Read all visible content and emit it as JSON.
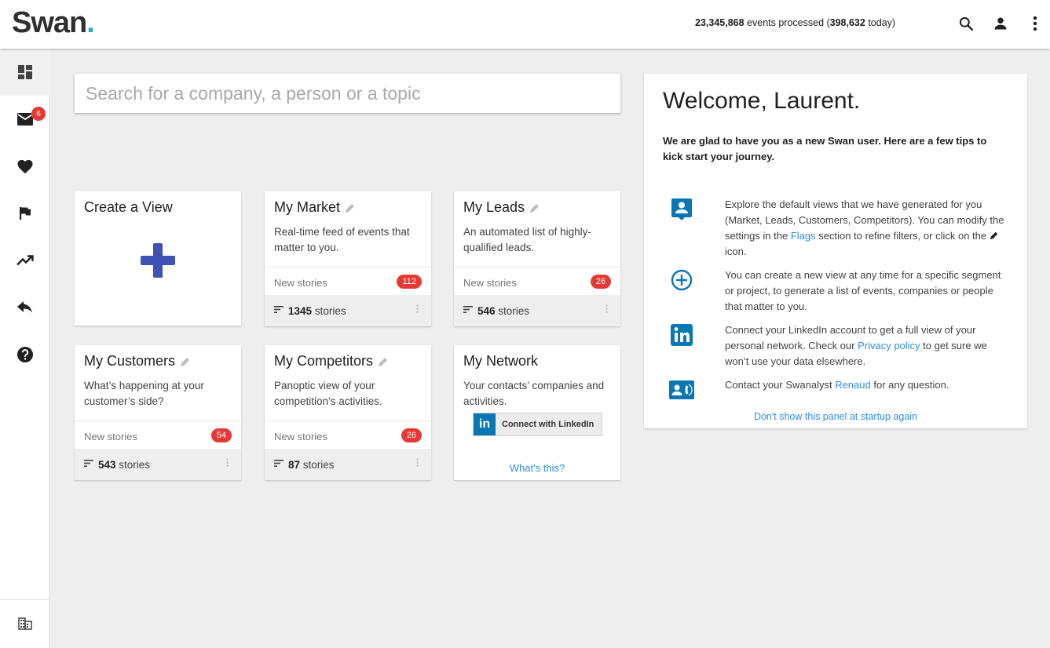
{
  "app": {
    "logo_text": "Swan",
    "logo_dot": ".",
    "brand_color": "#2f2f2f",
    "accent_color": "#2aa9e0"
  },
  "header": {
    "events_total": "23,345,868",
    "events_label": "events processed (",
    "events_today": "398,632",
    "events_suffix": "today)",
    "icons": [
      "search-icon",
      "account-icon",
      "more-vert-icon"
    ]
  },
  "sidebar": {
    "items": [
      {
        "icon": "dashboard-icon",
        "active": true
      },
      {
        "icon": "mail-icon",
        "badge": "6"
      },
      {
        "icon": "heart-icon"
      },
      {
        "icon": "flag-icon"
      },
      {
        "icon": "trending-up-icon"
      },
      {
        "icon": "reply-icon"
      },
      {
        "icon": "help-icon"
      },
      {
        "icon": "business-icon"
      }
    ]
  },
  "search": {
    "placeholder": "Search for a company, a person or a topic",
    "value": ""
  },
  "cards": {
    "create": {
      "title": "Create a View",
      "icon": "plus-icon",
      "icon_color": "#3f51b5"
    },
    "market": {
      "title": "My Market",
      "description": "Real-time feed of events that matter to you.",
      "new_label": "New stories",
      "new_count": "112",
      "stories_count": "1345",
      "stories_label": "stories"
    },
    "leads": {
      "title": "My Leads",
      "description": "An automated list of highly-qualified leads.",
      "new_label": "New stories",
      "new_count": "26",
      "stories_count": "546",
      "stories_label": "stories"
    },
    "customers": {
      "title": "My Customers",
      "description": "What’s happening at your customer’s side?",
      "new_label": "New stories",
      "new_count": "54",
      "stories_count": "543",
      "stories_label": "stories"
    },
    "competitors": {
      "title": "My Competitors",
      "description": "Panoptic view of your competition’s activities.",
      "new_label": "New stories",
      "new_count": "26",
      "stories_count": "87",
      "stories_label": "stories"
    },
    "network": {
      "title": "My Network",
      "description": "Your contacts’ companies and activities.",
      "linkedin_logo": "in",
      "linkedin_button": "Connect with LinkedIn",
      "whats_this": "What's this?"
    }
  },
  "welcome": {
    "title": "Welcome, Laurent.",
    "intro": "We are glad to have you as a new Swan user. Here are a few tips to kick start your journey.",
    "tips": [
      {
        "icon": "account-box-icon",
        "text_a": "Explore the default views that we have generated for you (Market, Leads, Customers, Competitors). You can modify the settings in the ",
        "link": "Flags",
        "text_b": " section to refine filters, or click on the ",
        "text_c": " icon."
      },
      {
        "icon": "add-circle-icon",
        "text_a": "You can create a new view at any time for a specific segment or project, to generate a list of events, companies or people that matter to you."
      },
      {
        "icon": "linkedin-icon",
        "text_a": "Connect your LinkedIn account to get a full view of your personal network. Check our ",
        "link": "Privacy policy",
        "text_b": " to get sure we won’t use your data elsewhere."
      },
      {
        "icon": "contact-phone-icon",
        "text_a": "Contact your Swanalyst ",
        "link": "Renaud",
        "text_b": " for any question."
      }
    ],
    "dont_show": "Don't show this panel at startup again",
    "icon_color": "#0a77b5"
  },
  "colors": {
    "badge": "#e53935",
    "link": "#2f8ee0",
    "background": "#eeeeee"
  }
}
